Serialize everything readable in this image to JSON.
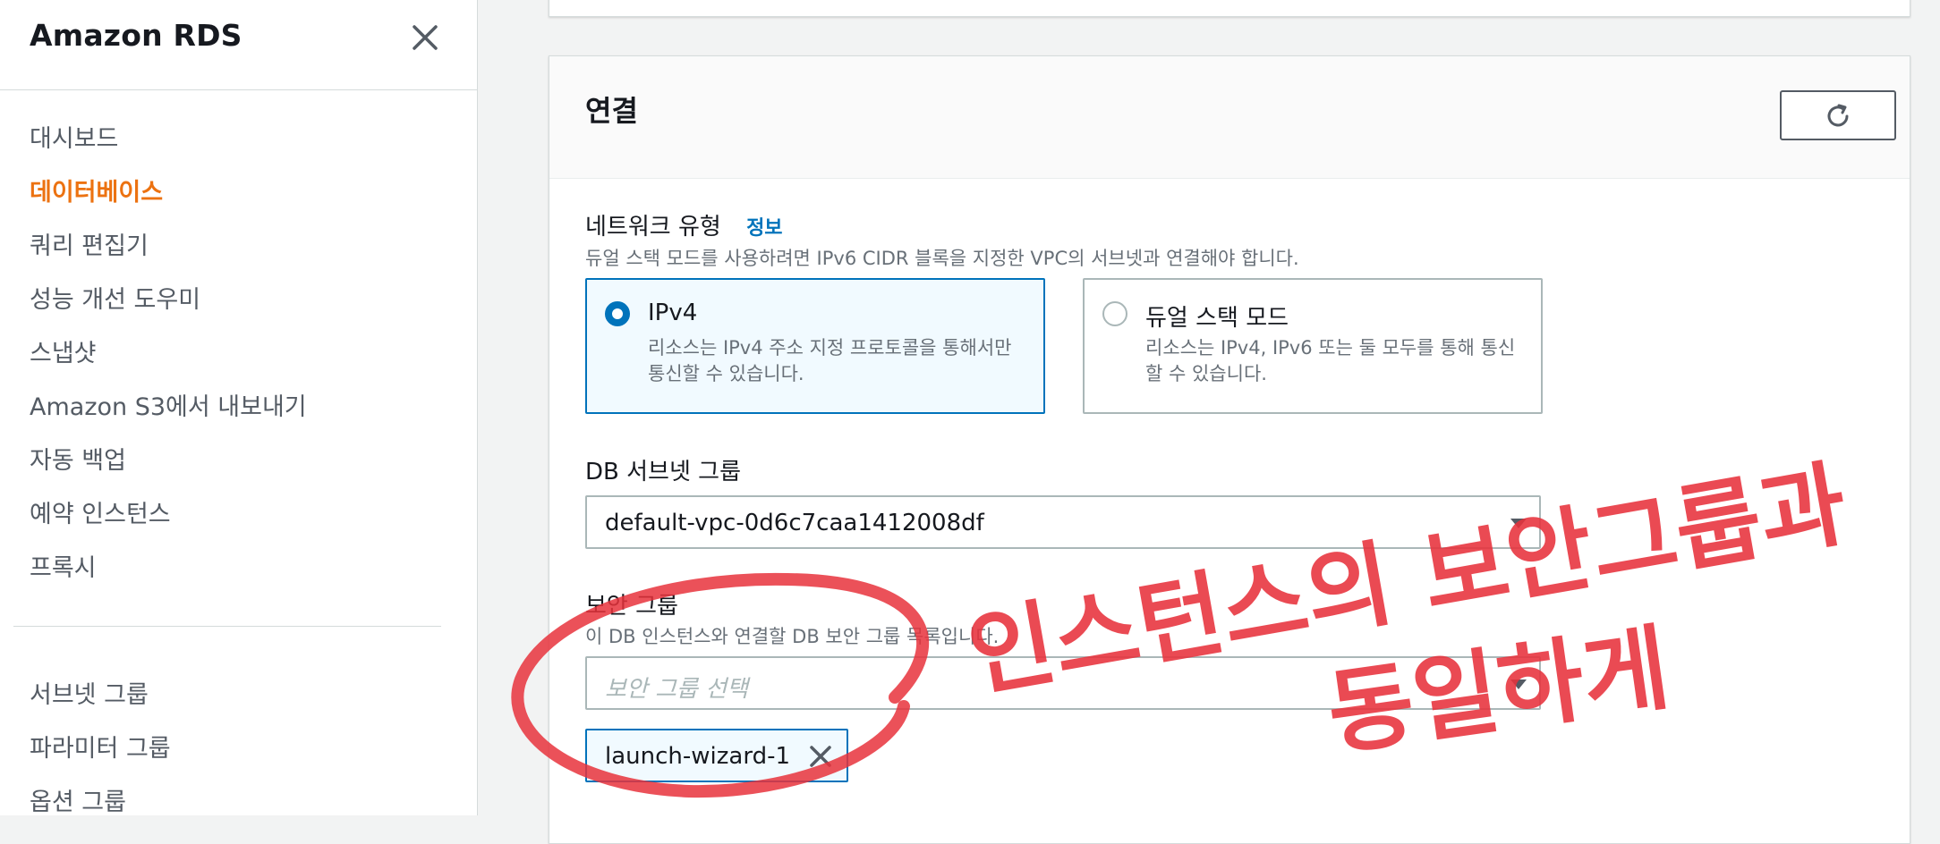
{
  "sidebar": {
    "title": "Amazon RDS",
    "close_icon": "close-icon",
    "items": [
      {
        "label": "대시보드",
        "active": false
      },
      {
        "label": "데이터베이스",
        "active": true
      },
      {
        "label": "쿼리 편집기",
        "active": false
      },
      {
        "label": "성능 개선 도우미",
        "active": false
      },
      {
        "label": "스냅샷",
        "active": false
      },
      {
        "label": "Amazon S3에서 내보내기",
        "active": false
      },
      {
        "label": "자동 백업",
        "active": false
      },
      {
        "label": "예약 인스턴스",
        "active": false
      },
      {
        "label": "프록시",
        "active": false
      }
    ],
    "items2": [
      {
        "label": "서브넷 그룹"
      },
      {
        "label": "파라미터 그룹"
      },
      {
        "label": "옵션 그룹"
      }
    ],
    "accent_color": "#ec7211"
  },
  "connection": {
    "title": "연결",
    "refresh_icon": "refresh-icon",
    "network_type": {
      "label": "네트워크 유형",
      "info": "정보",
      "description": "듀얼 스택 모드를 사용하려면 IPv6 CIDR 블록을 지정한 VPC의 서브넷과 연결해야 합니다.",
      "options": [
        {
          "title": "IPv4",
          "description": "리소스는 IPv4 주소 지정 프로토콜을 통해서만 통신할 수 있습니다.",
          "selected": true
        },
        {
          "title": "듀얼 스택 모드",
          "description": "리소스는 IPv4, IPv6 또는 둘 모두를 통해 통신할 수 있습니다.",
          "selected": false
        }
      ]
    },
    "subnet_group": {
      "label": "DB 서브넷 그룹",
      "value": "default-vpc-0d6c7caa1412008df"
    },
    "security_group": {
      "label": "보안 그룹",
      "description": "이 DB 인스턴스와 연결할 DB 보안 그룹 목록입니다.",
      "placeholder": "보안 그룹 선택",
      "tokens": [
        "launch-wizard-1"
      ]
    }
  },
  "annotation": {
    "line1": "인스턴스의 보안그룹과",
    "line2": "동일하게",
    "color": "#e8323c"
  },
  "colors": {
    "link": "#0073bb",
    "selected_bg": "#f1faff"
  }
}
